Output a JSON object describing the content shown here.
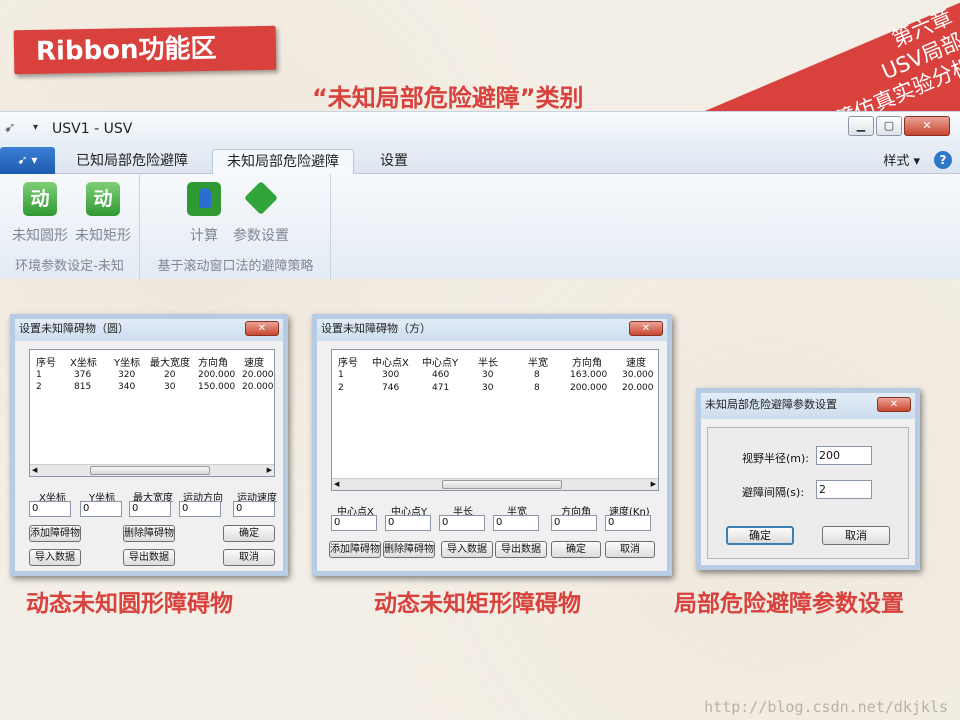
{
  "slide": {
    "banner": "Ribbon功能区",
    "chapter_lines": [
      "第六章",
      "USV局部",
      "危险避障仿真实验分析"
    ],
    "subtitle": "“未知局部危险避障”类别",
    "captions": [
      "动态未知圆形障碍物",
      "动态未知矩形障碍物",
      "局部危险避障参数设置"
    ],
    "watermark": "http://blog.csdn.net/dkjkls"
  },
  "app": {
    "window_title": "USV1 - USV",
    "tabs": [
      "已知局部危险避障",
      "未知局部危险避障",
      "设置"
    ],
    "active_tab_index": 1,
    "style_menu": "样式",
    "groups": [
      {
        "label": "环境参数设定-未知",
        "buttons": [
          {
            "label": "未知圆形",
            "icon": "dynamic-circle-icon",
            "glyph": "动"
          },
          {
            "label": "未知矩形",
            "icon": "dynamic-rect-icon",
            "glyph": "动"
          }
        ]
      },
      {
        "label": "基于滚动窗口法的避障策略",
        "buttons": [
          {
            "label": "计算",
            "icon": "calculate-icon"
          },
          {
            "label": "参数设置",
            "icon": "parameter-settings-icon"
          }
        ]
      }
    ]
  },
  "dialog_circle": {
    "title": "设置未知障碍物（圆）",
    "columns": [
      "序号",
      "X坐标",
      "Y坐标",
      "最大宽度",
      "方向角",
      "速度"
    ],
    "rows": [
      [
        "1",
        "376",
        "320",
        "20",
        "200.000",
        "20.000"
      ],
      [
        "2",
        "815",
        "340",
        "30",
        "150.000",
        "20.000"
      ]
    ],
    "fields": [
      {
        "label": "X坐标",
        "value": "0"
      },
      {
        "label": "Y坐标",
        "value": "0"
      },
      {
        "label": "最大宽度",
        "value": "0"
      },
      {
        "label": "运动方向",
        "value": "0"
      },
      {
        "label": "运动速度",
        "value": "0"
      }
    ],
    "buttons": [
      "添加障碍物",
      "删除障碍物",
      "确定",
      "导入数据",
      "导出数据",
      "取消"
    ]
  },
  "dialog_rect": {
    "title": "设置未知障碍物（方）",
    "columns": [
      "序号",
      "中心点X",
      "中心点Y",
      "半长",
      "半宽",
      "方向角",
      "速度"
    ],
    "rows": [
      [
        "1",
        "300",
        "460",
        "30",
        "8",
        "163.000",
        "30.000"
      ],
      [
        "2",
        "746",
        "471",
        "30",
        "8",
        "200.000",
        "20.000"
      ]
    ],
    "fields": [
      {
        "label": "中心点X",
        "value": "0"
      },
      {
        "label": "中心点Y",
        "value": "0"
      },
      {
        "label": "半长",
        "value": "0"
      },
      {
        "label": "半宽",
        "value": "0"
      },
      {
        "label": "方向角",
        "value": "0"
      },
      {
        "label": "速度(Kn)",
        "value": "0"
      }
    ],
    "buttons": [
      "添加障碍物",
      "删除障碍物",
      "导入数据",
      "导出数据",
      "确定",
      "取消"
    ]
  },
  "dialog_params": {
    "title": "未知局部危险避障参数设置",
    "fields": [
      {
        "label": "视野半径(m):",
        "value": "200"
      },
      {
        "label": "避障间隔(s):",
        "value": "2"
      }
    ],
    "buttons": [
      "确定",
      "取消"
    ]
  },
  "colors": {
    "accent": "#d9413d",
    "ribbon_blue": "#2f78c9",
    "icon_green": "#2f9a34"
  }
}
